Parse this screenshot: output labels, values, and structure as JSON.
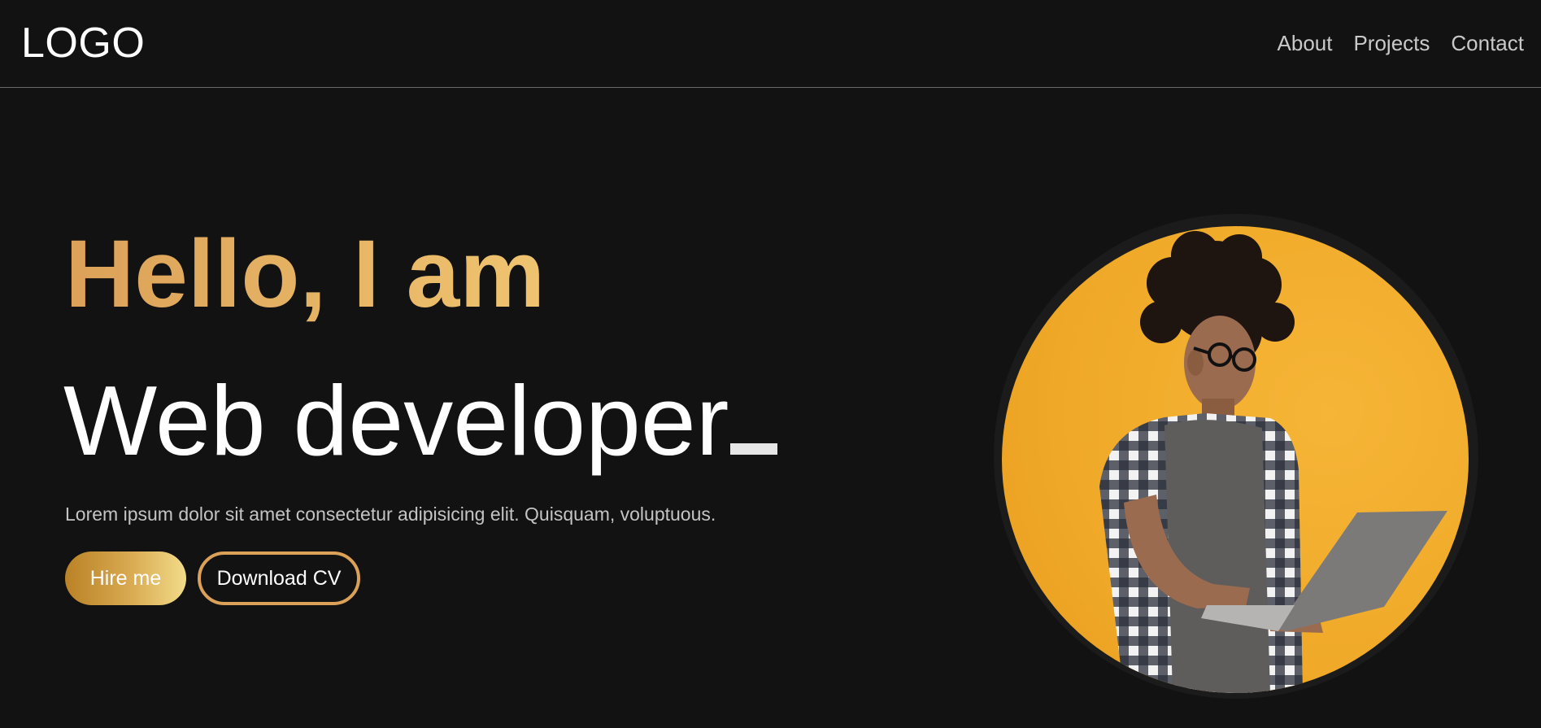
{
  "header": {
    "logo": "LOGO",
    "nav": [
      {
        "label": "About"
      },
      {
        "label": "Projects"
      },
      {
        "label": "Contact"
      }
    ]
  },
  "hero": {
    "greeting": "Hello, I am",
    "role": "Web developer",
    "description": "Lorem ipsum dolor sit amet consectetur adipisicing elit. Quisquam, voluptuous.",
    "buttons": {
      "hire": "Hire me",
      "cv": "Download CV"
    },
    "portrait_alt": "portrait-photo"
  },
  "colors": {
    "background": "#121212",
    "accent": "#dba158",
    "accent_light": "#efc470",
    "portrait_bg": "#f0a928",
    "nav_text": "#c9c9c9",
    "divider": "#6a6a6a"
  }
}
